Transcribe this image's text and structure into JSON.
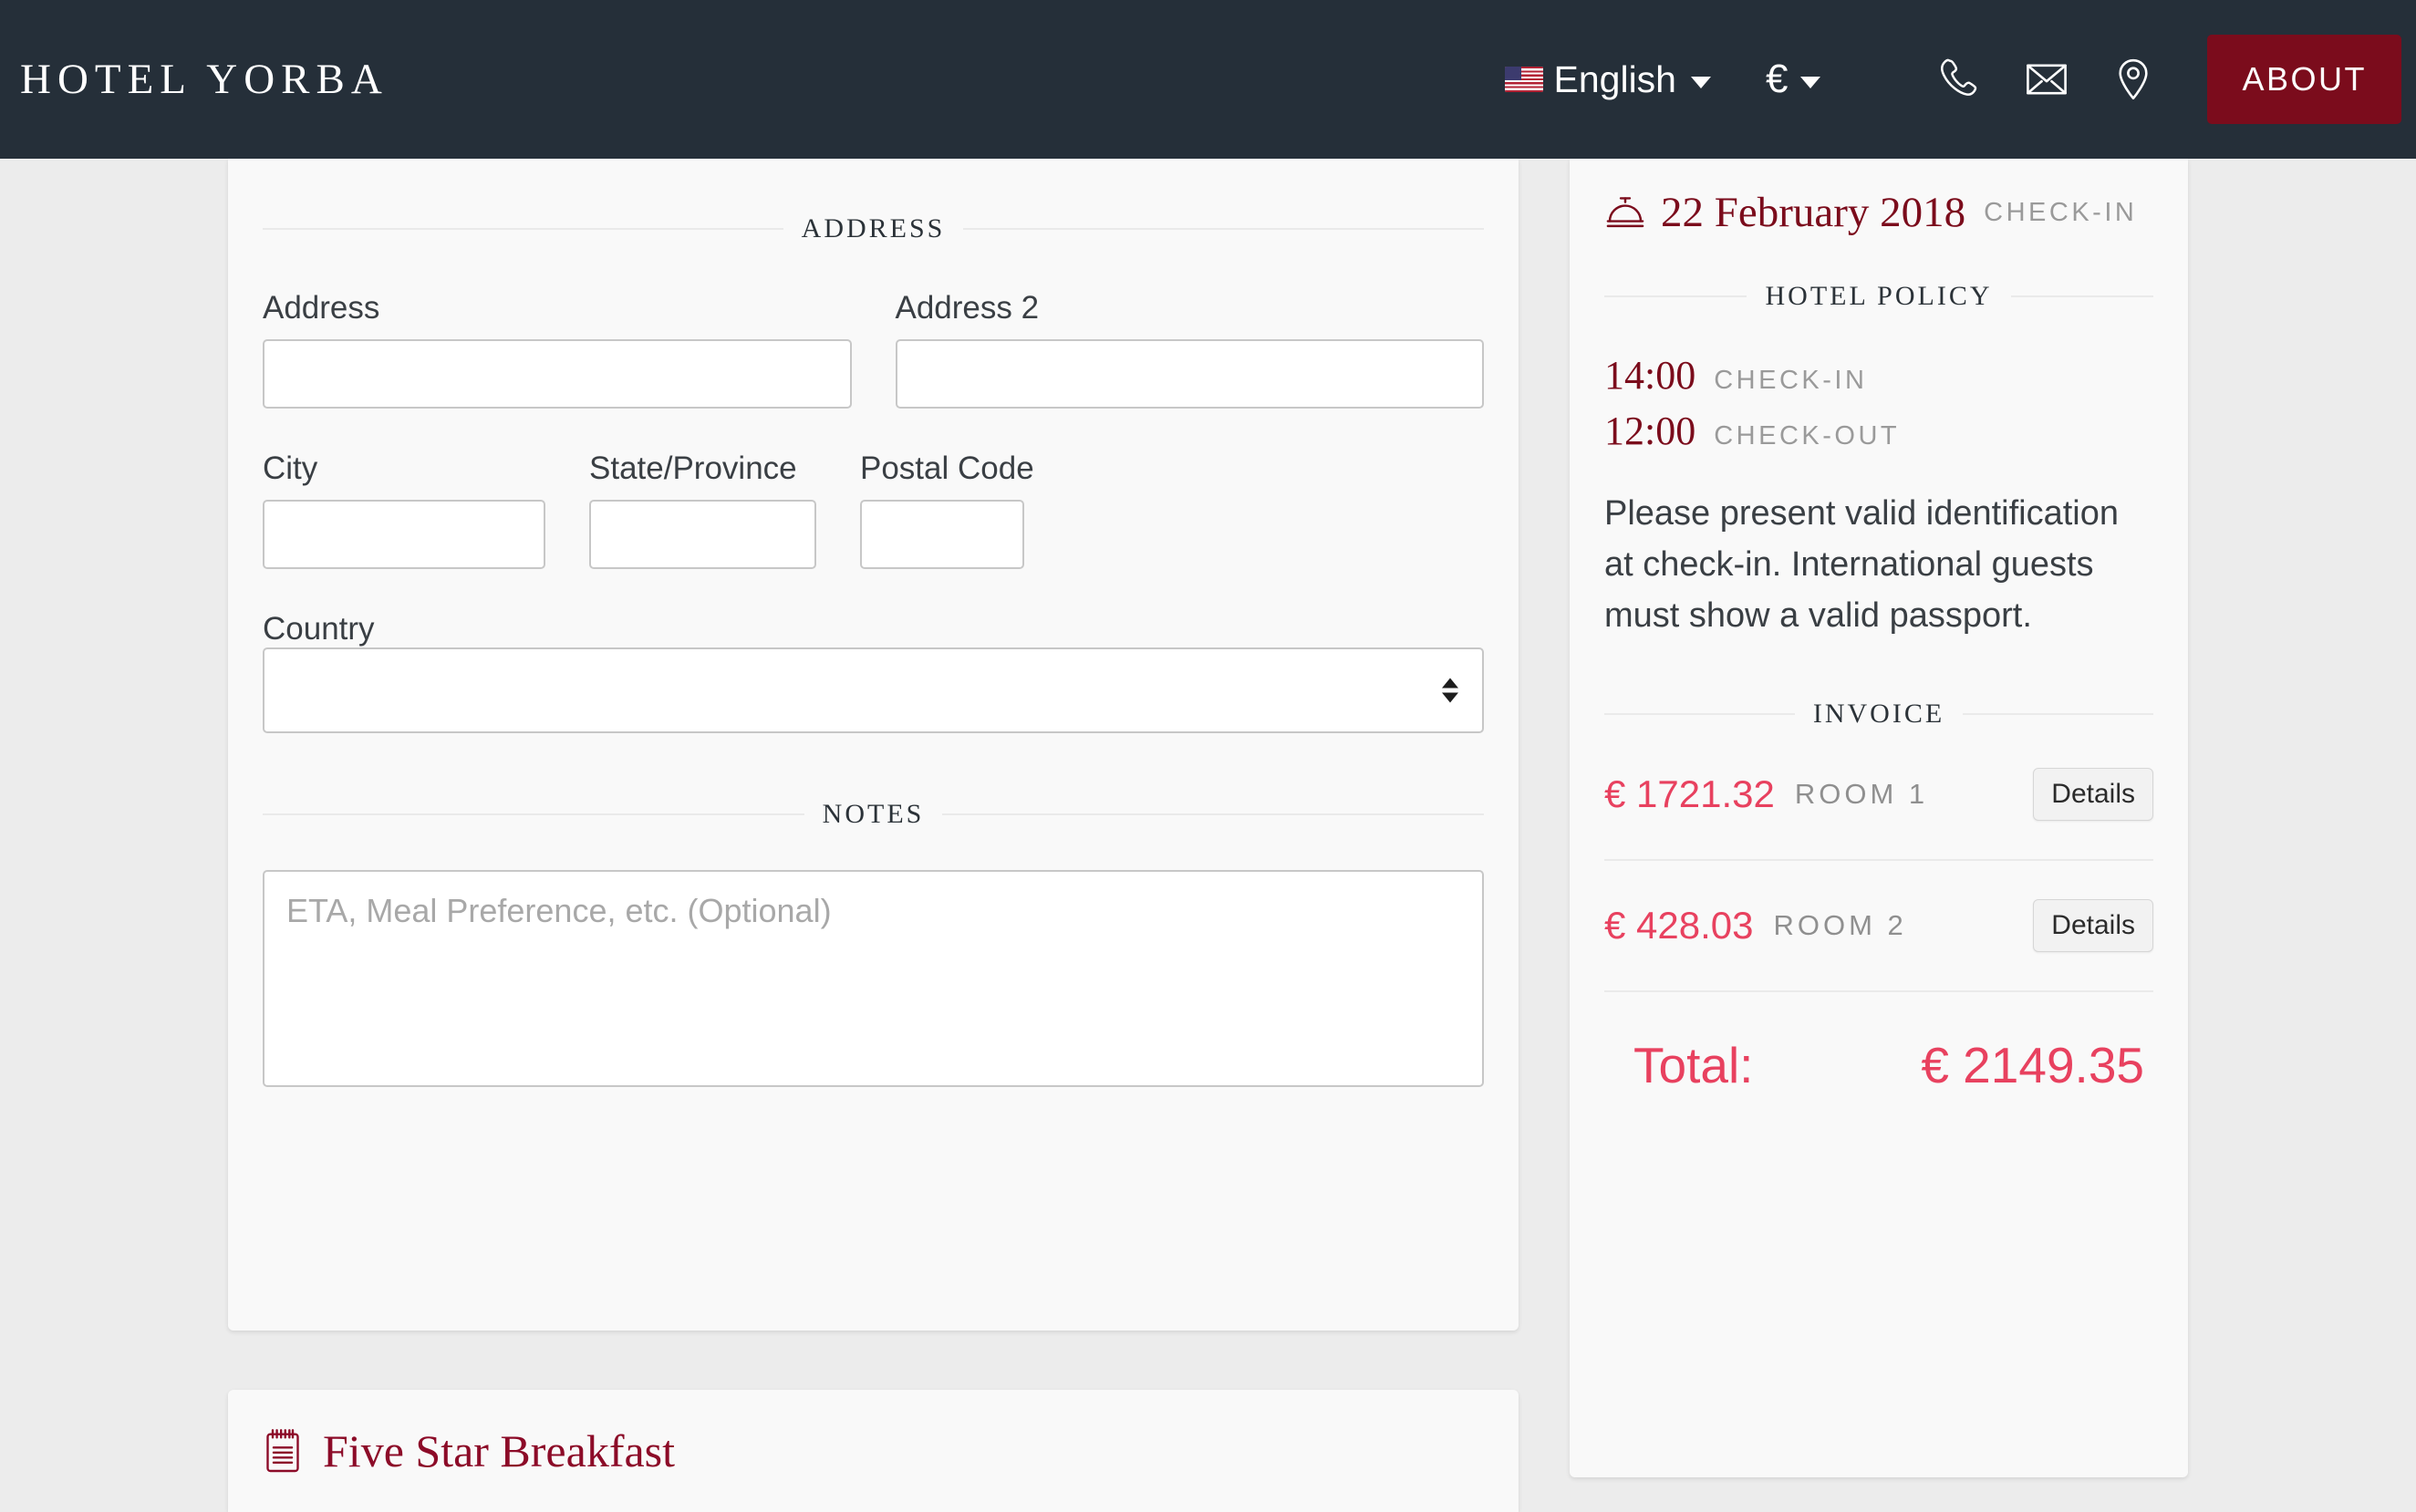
{
  "header": {
    "brand": "HOTEL YORBA",
    "language": {
      "label": "English",
      "flag_icon": "us-flag-icon"
    },
    "currency": {
      "label": "€"
    },
    "icons": [
      "phone-icon",
      "envelope-icon",
      "location-pin-icon"
    ],
    "about_label": "ABOUT",
    "accent_color": "#7b0c1c",
    "background_color": "#252f39"
  },
  "form": {
    "address_section_title": "ADDRESS",
    "address_label": "Address",
    "address_value": "",
    "address2_label": "Address 2",
    "address2_value": "",
    "city_label": "City",
    "city_value": "",
    "state_label": "State/Province",
    "state_value": "",
    "postal_label": "Postal Code",
    "postal_value": "",
    "country_label": "Country",
    "country_value": "",
    "notes_section_title": "NOTES",
    "notes_placeholder": "ETA, Meal Preference, etc. (Optional)",
    "notes_value": ""
  },
  "breakfast": {
    "title": "Five Star Breakfast",
    "icon": "notepad-icon"
  },
  "sidebar": {
    "checkin_date": "22 February 2018",
    "checkin_date_tag": "CHECK-IN",
    "bell_icon": "service-bell-icon",
    "policy_title": "HOTEL POLICY",
    "checkin_time": "14:00",
    "checkin_time_tag": "CHECK-IN",
    "checkout_time": "12:00",
    "checkout_time_tag": "CHECK-OUT",
    "policy_text": "Please present valid identification at check-in. International guests must show a valid passport.",
    "invoice_title": "INVOICE",
    "invoice_rows": [
      {
        "price": "€ 1721.32",
        "label": "ROOM 1",
        "details_label": "Details"
      },
      {
        "price": "€ 428.03",
        "label": "ROOM 2",
        "details_label": "Details"
      }
    ],
    "total_label": "Total:",
    "total_value": "€ 2149.35",
    "price_color": "#e8415f",
    "date_color": "#7b0c1c"
  }
}
